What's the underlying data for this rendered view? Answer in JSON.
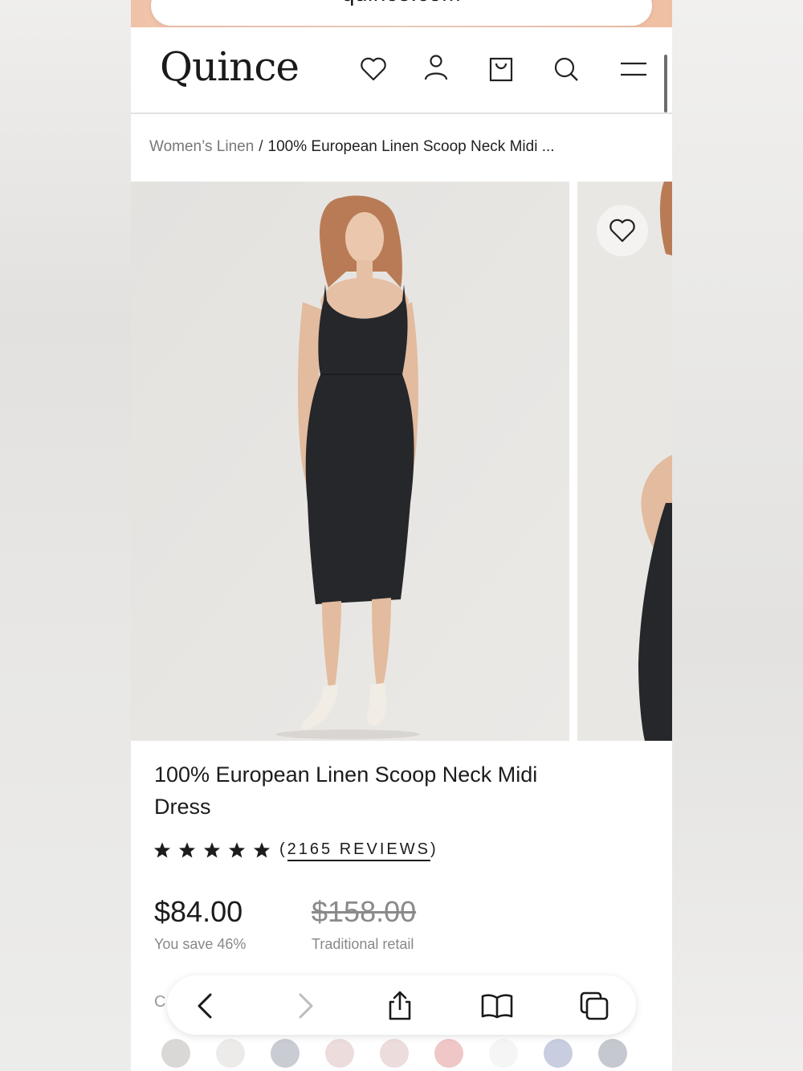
{
  "browser": {
    "url": "quince.com"
  },
  "header": {
    "logo": "Quince",
    "icons": [
      "heart-icon",
      "account-icon",
      "bag-icon",
      "search-icon",
      "menu-icon"
    ]
  },
  "breadcrumb": {
    "parent": "Women’s Linen",
    "separator": "/",
    "current": "100% European Linen Scoop Neck Midi ..."
  },
  "product": {
    "title": "100% European Linen Scoop Neck Midi Dress",
    "rating_stars": 5,
    "reviews_open": "(",
    "reviews_label": "2165 REVIEWS",
    "reviews_close": ")",
    "price": "$84.00",
    "savings": "You save 46%",
    "retail_price": "$158.00",
    "retail_label": "Traditional retail",
    "peek_text": "C"
  },
  "swatches": {
    "colors": [
      "#d9d8d6",
      "#ecebea",
      "#c9ccd3",
      "#ecdcdc",
      "#ecdcdc",
      "#efc7c7",
      "#f5f5f5",
      "#c8cde0",
      "#c6c8cf"
    ]
  },
  "toolbar": {
    "items": [
      "back-icon",
      "forward-icon",
      "share-icon",
      "bookmarks-icon",
      "tabs-icon"
    ]
  },
  "colors": {
    "accent_top": "#f0c2a8",
    "text": "#1c1c1c",
    "muted": "#888888"
  }
}
